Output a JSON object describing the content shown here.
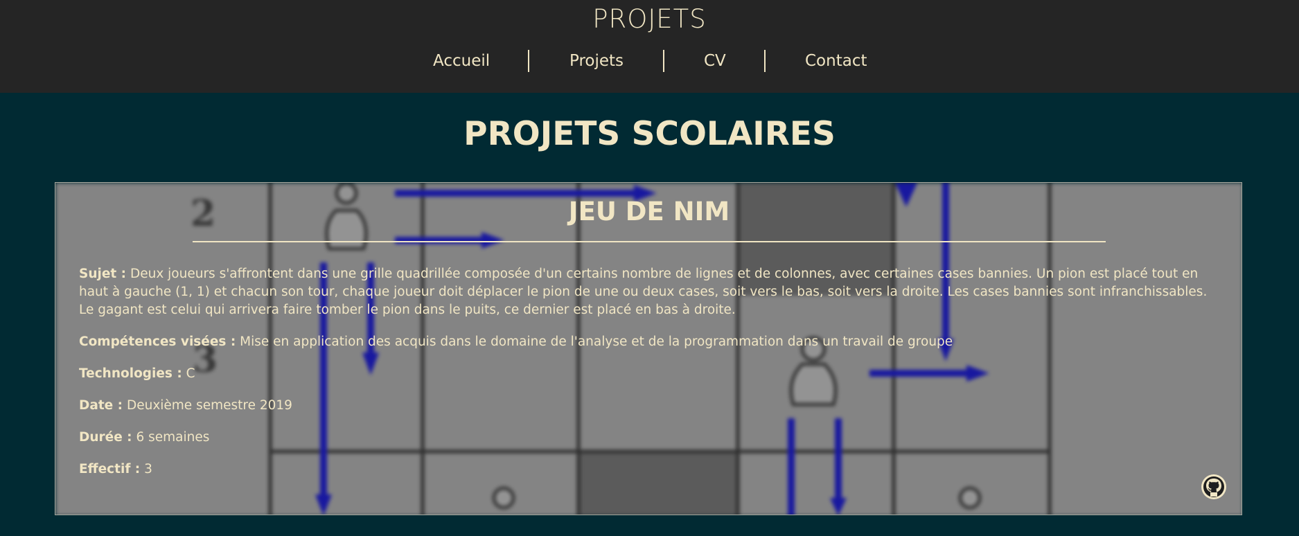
{
  "header": {
    "title": "PROJETS",
    "nav": [
      "Accueil",
      "Projets",
      "CV",
      "Contact"
    ]
  },
  "section": {
    "title": "PROJETS SCOLAIRES"
  },
  "project": {
    "title": "JEU DE NIM",
    "subject_label": "Sujet :",
    "subject": "Deux joueurs s'affrontent dans une grille quadrillée composée d'un certains nombre de lignes et de colonnes, avec certaines cases bannies. Un pion est placé tout en haut à gauche (1, 1) et chacun son tour, chaque joueur doit déplacer le pion de une ou deux cases, soit vers le bas, soit vers la droite. Les cases bannies sont infranchissables. Le gagant est celui qui arrivera faire tomber le pion dans le puits, ce dernier est placé en bas à droite.",
    "skills_label": "Compétences visées :",
    "skills": "Mise en application des acquis dans le domaine de l'analyse et de la programmation dans un travail de groupe",
    "tech_label": "Technologies :",
    "tech": "C",
    "date_label": "Date :",
    "date": "Deuxième semestre 2019",
    "duration_label": "Durée :",
    "duration": "6 semaines",
    "team_label": "Effectif :",
    "team": "3",
    "background_labels": [
      "2",
      "3"
    ],
    "link_icon": "github-icon"
  },
  "colors": {
    "topbar": "#252525",
    "page": "#012a33",
    "text": "#f1e6c4",
    "arrow": "#1a1aa6",
    "board": "#8a8a8a"
  }
}
